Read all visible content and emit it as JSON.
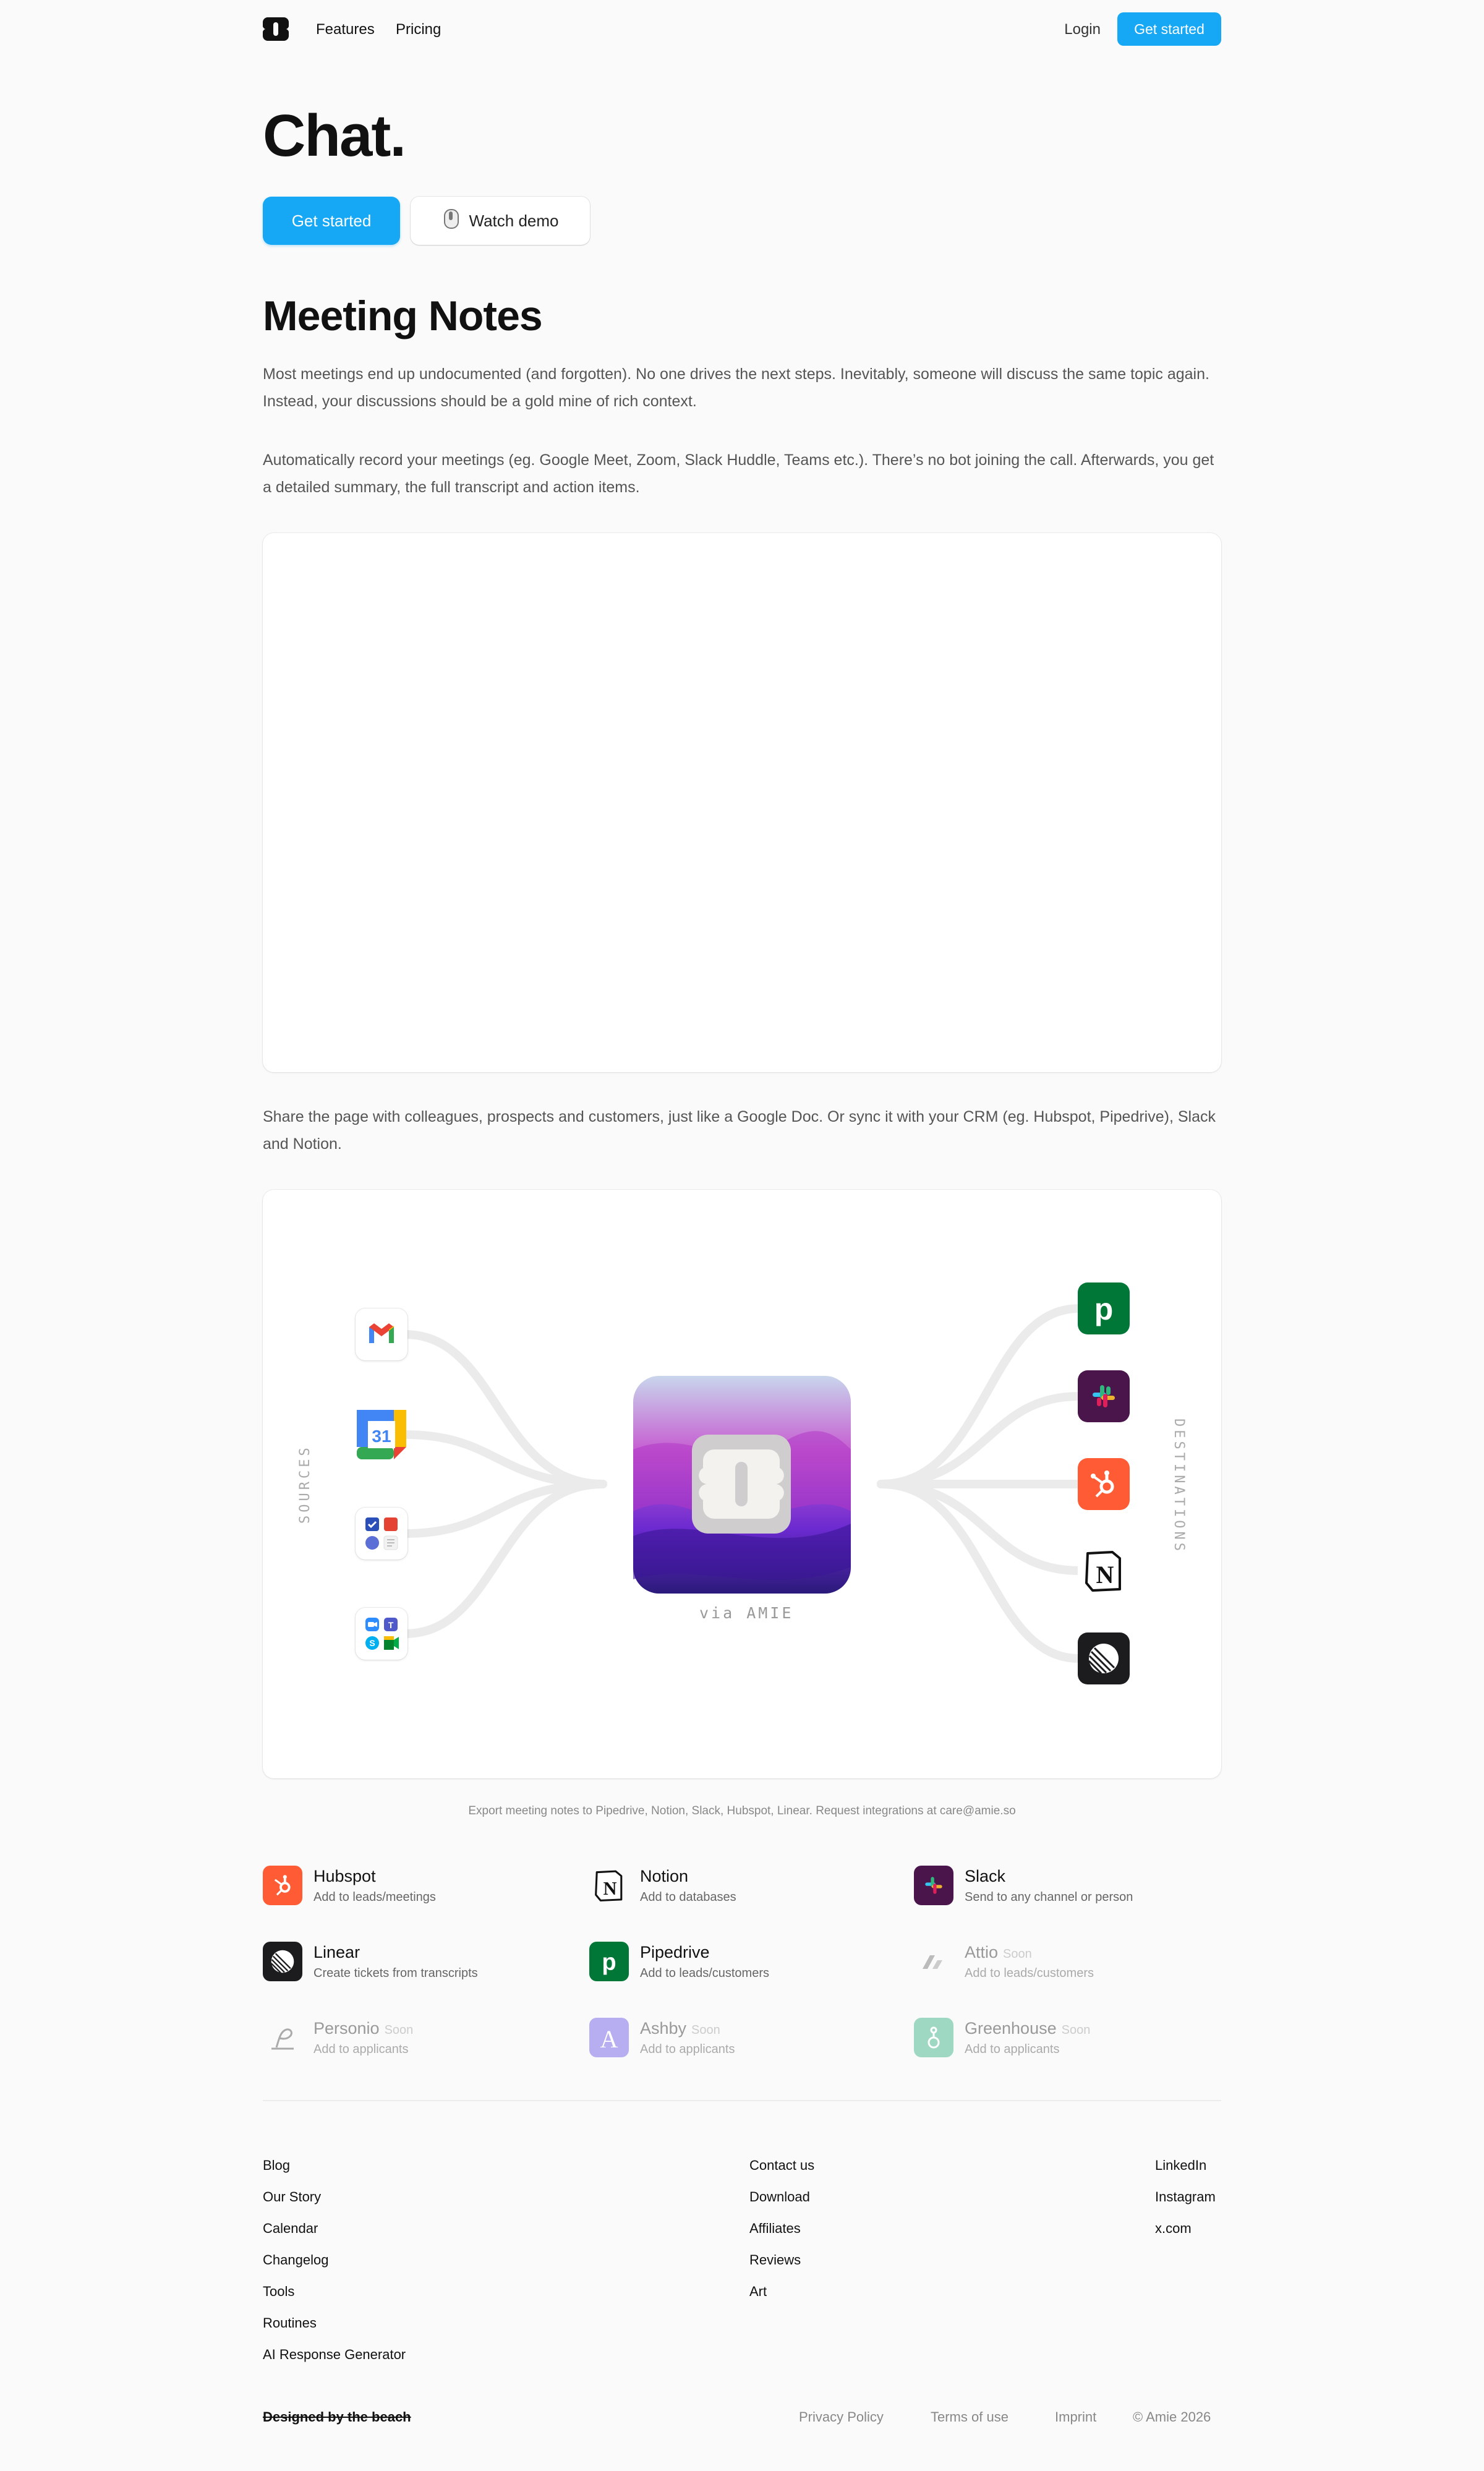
{
  "nav": {
    "features": "Features",
    "pricing": "Pricing",
    "login": "Login",
    "cta": "Get started"
  },
  "hero": {
    "title": "Chat.",
    "primary_button": "Get started",
    "secondary_button": "Watch demo"
  },
  "meeting_notes": {
    "title": "Meeting Notes",
    "paragraph1": "Most meetings end up undocumented (and forgotten). No one drives the next steps. Inevitably, someone will discuss the same topic again. Instead, your discussions should be a gold mine of rich context.",
    "paragraph2": "Automatically record your meetings (eg. Google Meet, Zoom, Slack Huddle, Teams etc.). There’s no bot joining the call. Afterwards, you get a detailed summary, the full transcript and action items.",
    "paragraph3": "Share the page with colleagues, prospects and customers, just like a Google Doc. Or sync it with your CRM (eg. Hubspot, Pipedrive), Slack and Notion."
  },
  "flow": {
    "sources_label": "SOURCES",
    "destinations_label": "DESTINATIONS",
    "via_label": "via AMIE",
    "calendar_day": "31",
    "notion_letter": "N",
    "pipedrive_letter": "p",
    "sources": [
      "gmail-icon",
      "google-calendar-icon",
      "task-apps-icon",
      "meeting-apps-icon"
    ],
    "destinations": [
      "pipedrive-icon",
      "slack-icon",
      "hubspot-icon",
      "notion-icon",
      "linear-icon"
    ]
  },
  "caption": "Export meeting notes to Pipedrive, Notion, Slack, Hubspot, Linear. Request integrations at care@amie.so",
  "integrations": {
    "soon_tag": "Soon",
    "hubspot": {
      "name": "Hubspot",
      "desc": "Add to leads/meetings"
    },
    "notion": {
      "name": "Notion",
      "desc": "Add to databases"
    },
    "slack": {
      "name": "Slack",
      "desc": "Send to any channel or person"
    },
    "linear": {
      "name": "Linear",
      "desc": "Create tickets from transcripts"
    },
    "pipedrive": {
      "name": "Pipedrive",
      "desc": "Add to leads/customers"
    },
    "attio": {
      "name": "Attio",
      "desc": "Add to leads/customers"
    },
    "personio": {
      "name": "Personio",
      "desc": "Add to applicants"
    },
    "ashby": {
      "name": "Ashby",
      "desc": "Add to applicants"
    },
    "greenhouse": {
      "name": "Greenhouse",
      "desc": "Add to applicants"
    }
  },
  "footer": {
    "col1": [
      "Blog",
      "Our Story",
      "Calendar",
      "Changelog",
      "Tools",
      "Routines",
      "AI Response Generator"
    ],
    "col2": [
      "Contact us",
      "Download",
      "Affiliates",
      "Reviews",
      "Art"
    ],
    "col3": [
      "LinkedIn",
      "Instagram",
      "x.com"
    ],
    "designed": "Designed by the beach",
    "privacy": "Privacy Policy",
    "terms": "Terms of use",
    "imprint": "Imprint",
    "copyright": "© Amie 2026"
  },
  "colors": {
    "accent": "#16a7f5",
    "hubspot": "#ff5c35",
    "pipedrive": "#017737",
    "slack_bg": "#4a154b",
    "linear_bg": "#1c1c1e"
  }
}
